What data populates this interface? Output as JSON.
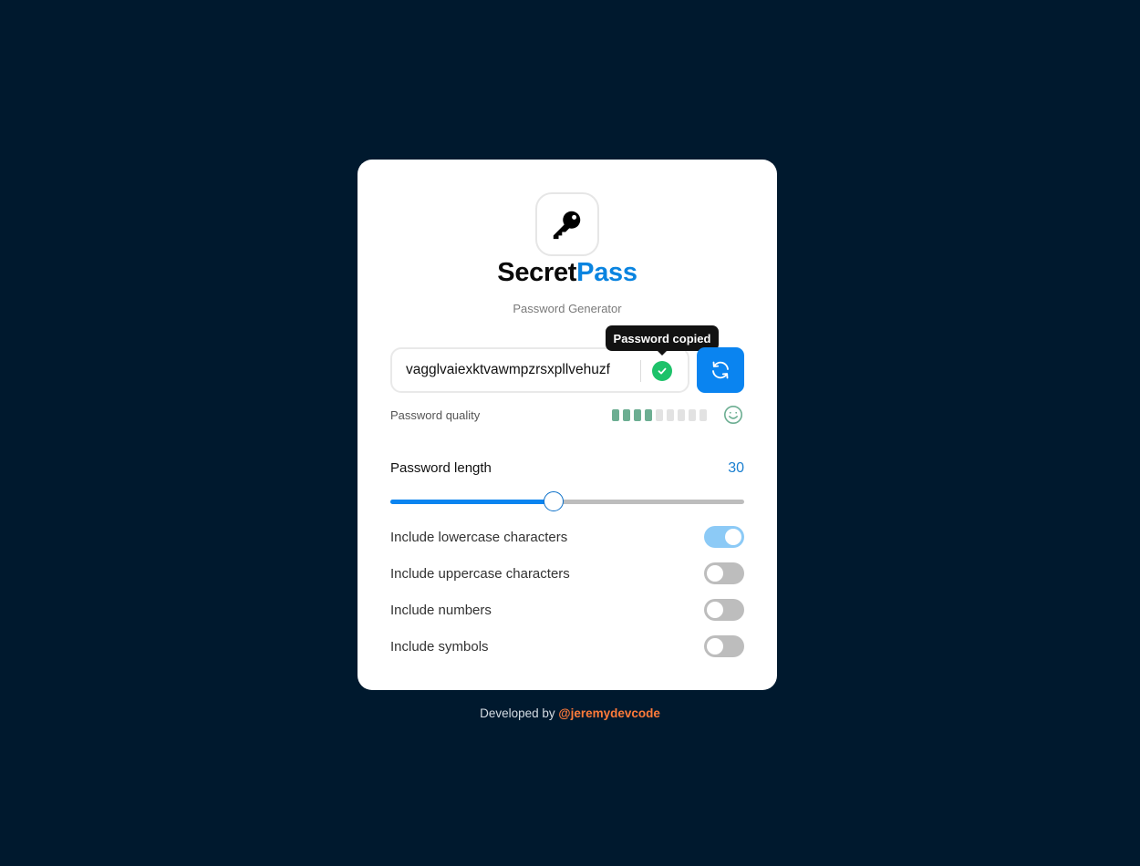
{
  "brand": {
    "part1": "Secret",
    "part2": "Pass",
    "subtitle": "Password Generator"
  },
  "password": {
    "value": "vagglvaiexktvawmpzrsxpllvehuzf",
    "tooltip": "Password copied"
  },
  "quality": {
    "label": "Password quality",
    "segments_total": 9,
    "segments_filled": 4,
    "icon": "smiley-icon"
  },
  "length": {
    "label": "Password length",
    "value": "30",
    "min": 1,
    "max": 64,
    "current": 30
  },
  "options": [
    {
      "label": "Include lowercase characters",
      "on": true
    },
    {
      "label": "Include uppercase characters",
      "on": false
    },
    {
      "label": "Include numbers",
      "on": false
    },
    {
      "label": "Include symbols",
      "on": false
    }
  ],
  "footer": {
    "prefix": "Developed by",
    "handle": "@jeremydevcode"
  },
  "colors": {
    "background": "#00192e",
    "accent": "#0a84f0",
    "success": "#1ec26a",
    "quality": "#6cae92",
    "footer_link": "#ff7b3a"
  }
}
